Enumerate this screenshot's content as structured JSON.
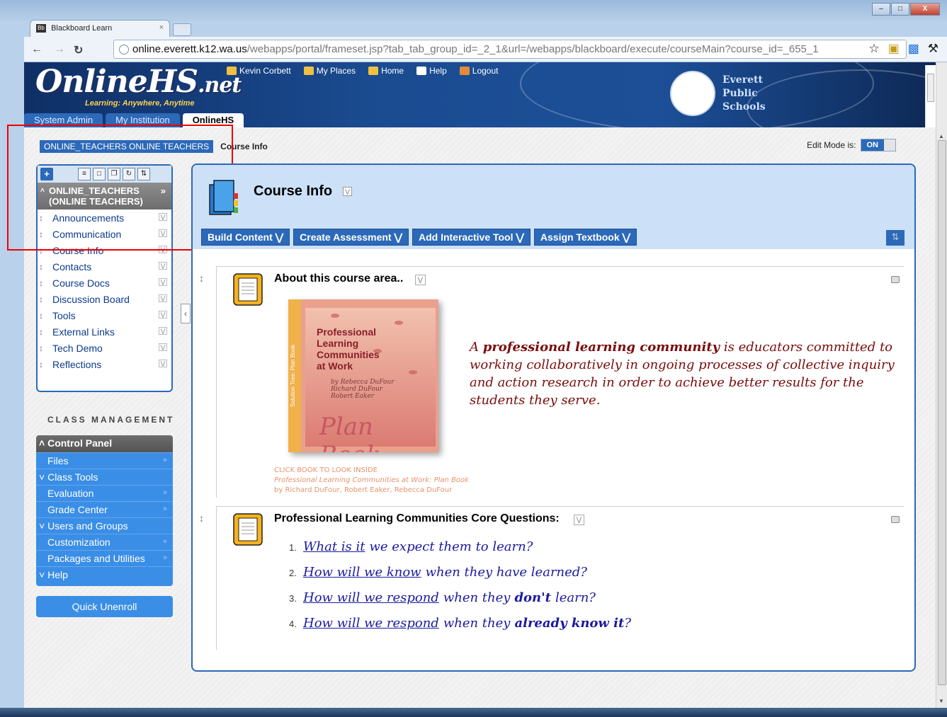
{
  "browser": {
    "tab_title": "Blackboard Learn",
    "tab_favicon": "Bb",
    "url_host": "online.everett.k12.wa.us",
    "url_path": "/webapps/portal/frameset.jsp?tab_tab_group_id=_2_1&url=/webapps/blackboard/execute/courseMain?course_id=_655_1",
    "close_glyph": "×",
    "win_min": "–",
    "win_max": "□",
    "win_close": "X"
  },
  "header": {
    "logo_main": "OnlineHS",
    "logo_suffix": ".net",
    "tagline": "Learning: Anywhere, Anytime",
    "user_links": [
      "Kevin Corbett",
      "My Places",
      "Home",
      "Help",
      "Logout"
    ],
    "district": [
      "Everett",
      "Public",
      "Schools"
    ],
    "tabs": [
      "System Admin",
      "My Institution",
      "OnlineHS"
    ]
  },
  "breadcrumb": {
    "course": "ONLINE_TEACHERS ONLINE TEACHERS",
    "current": "Course Info"
  },
  "edit_mode": {
    "label": "Edit Mode is:",
    "state": "ON"
  },
  "course_menu": {
    "title": "ONLINE_TEACHERS (ONLINE TEACHERS)",
    "items": [
      "Announcements",
      "Communication",
      "Course Info",
      "Contacts",
      "Course Docs",
      "Discussion Board",
      "Tools",
      "External Links",
      "Tech Demo",
      "Reflections"
    ]
  },
  "class_management": {
    "heading": "CLASS MANAGEMENT",
    "panel_title": "Control Panel",
    "items": [
      {
        "label": "Files",
        "kind": "sub"
      },
      {
        "label": "Class Tools",
        "kind": "expanded"
      },
      {
        "label": "Evaluation",
        "kind": "sub"
      },
      {
        "label": "Grade Center",
        "kind": "sub"
      },
      {
        "label": "Users and Groups",
        "kind": "expanded"
      },
      {
        "label": "Customization",
        "kind": "sub"
      },
      {
        "label": "Packages and Utilities",
        "kind": "sub"
      },
      {
        "label": "Help",
        "kind": "expanded"
      }
    ],
    "quick_unenroll": "Quick Unenroll"
  },
  "main": {
    "title": "Course Info",
    "actions": [
      "Build Content",
      "Create Assessment",
      "Add Interactive Tool",
      "Assign Textbook"
    ],
    "items": [
      {
        "title": "About this course area..",
        "book": {
          "spine": "Solution Tree: Plan Book",
          "title_lines": [
            "Professional",
            "Learning",
            "Communities",
            "at Work"
          ],
          "authors": [
            "by Rebecca DuFour",
            "Richard DuFour",
            "Robert Eaker"
          ],
          "subtitle": "Plan Book"
        },
        "captions": [
          "CLICK BOOK TO LOOK INSIDE",
          "Professional Learning Communities at Work: Plan Book",
          "by Richard DuFour, Robert Eaker, Rebecca DuFour"
        ],
        "quote": {
          "lead": "A ",
          "bold": "professional learning community",
          "rest": " is educators committed to working collaboratively in ongoing processes of collective inquiry and action research in order to achieve better results for the students they serve."
        }
      },
      {
        "title": "Professional Learning Communities Core Questions:",
        "questions": [
          {
            "n": "1.",
            "link": "What is it",
            "pre": "we expect them to learn?",
            "bold": "",
            "post": ""
          },
          {
            "n": "2.",
            "link": "How will we know",
            "pre": "when they have learned?",
            "bold": "",
            "post": ""
          },
          {
            "n": "3.",
            "link": "How will we respond",
            "pre": "when they",
            "bold": "don't",
            "post": "learn?"
          },
          {
            "n": "4.",
            "link": "How will we respond",
            "pre": "when they",
            "bold": "already know it",
            "post": "?"
          }
        ]
      }
    ]
  },
  "colors": {
    "accent": "#2c69b8",
    "quote": "#7a0c0c",
    "question": "#1a1aa0",
    "highlight_box": "#e00000"
  }
}
